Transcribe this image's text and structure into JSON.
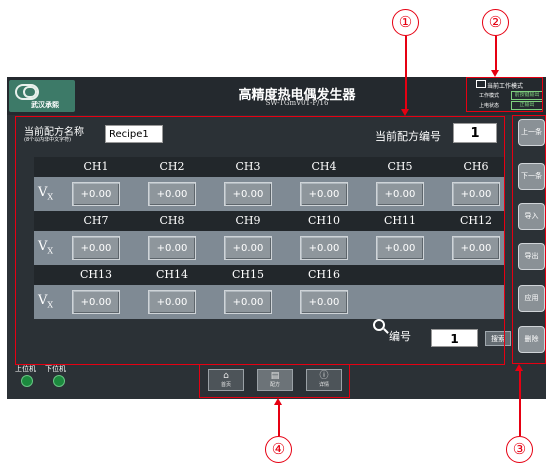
{
  "header": {
    "brand": "武汉承熙",
    "title": "高精度热电偶发生器",
    "model": "SW-TGmV01-P/16",
    "mode_panel": {
      "title": "当前工作模式",
      "work_mode_label": "工作模式",
      "work_mode_value": "前按键输出",
      "host_state_label": "上电状态",
      "host_state_value": "正输出"
    }
  },
  "recipe": {
    "name_label": "当前配方名称",
    "name_hint": "(8个以内非中文字符)",
    "name_value": "Recipe1",
    "number_label": "当前配方编号",
    "number_value": "1"
  },
  "channels": {
    "row_label_main": "V",
    "row_label_sub": "X",
    "rows": [
      {
        "labels": [
          "CH1",
          "CH2",
          "CH3",
          "CH4",
          "CH5",
          "CH6"
        ],
        "values": [
          "+0.00",
          "+0.00",
          "+0.00",
          "+0.00",
          "+0.00",
          "+0.00"
        ]
      },
      {
        "labels": [
          "CH7",
          "CH8",
          "CH9",
          "CH10",
          "CH11",
          "CH12"
        ],
        "values": [
          "+0.00",
          "+0.00",
          "+0.00",
          "+0.00",
          "+0.00",
          "+0.00"
        ]
      },
      {
        "labels": [
          "CH13",
          "CH14",
          "CH15",
          "CH16"
        ],
        "values": [
          "+0.00",
          "+0.00",
          "+0.00",
          "+0.00"
        ]
      }
    ]
  },
  "search": {
    "label": "编号",
    "value": "1",
    "button": "搜索"
  },
  "side_buttons": [
    "上一条",
    "下一条",
    "导入",
    "导出",
    "应用",
    "删除"
  ],
  "status": {
    "upper_label": "上位机",
    "lower_label": "下位机"
  },
  "nav": {
    "home": "首页",
    "recipe": "配方",
    "details": "详情"
  },
  "annotations": [
    "①",
    "②",
    "③",
    "④"
  ],
  "colors": {
    "annotation": "#e60012",
    "screen_bg": "#2b3136",
    "value_row": "#7f8a94",
    "led": "#1c8a3e"
  }
}
